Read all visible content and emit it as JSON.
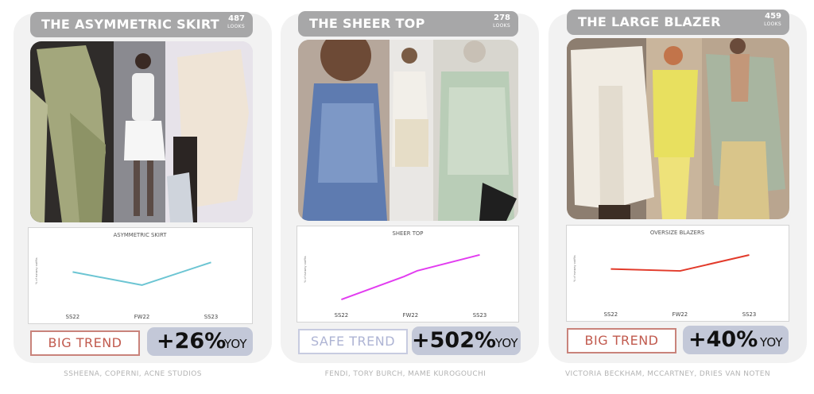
{
  "cards": [
    {
      "title": "THE ASYMMETRIC SKIRT",
      "looks_count": "487",
      "looks_label": "LOOKS",
      "trend_label": "BIG TREND",
      "yoy_value": "+26%",
      "yoy_label": "YOY",
      "brands": "SSHEENA, COPERNI, ACNE STUDIOS"
    },
    {
      "title": "THE SHEER TOP",
      "looks_count": "278",
      "looks_label": "LOOKS",
      "trend_label": "SAFE TREND",
      "yoy_value": "+502%",
      "yoy_label": "YOY",
      "brands": "FENDI, TORY BURCH, MAME KUROGOUCHI"
    },
    {
      "title": "THE LARGE BLAZER",
      "looks_count": "459",
      "looks_label": "LOOKS",
      "trend_label": "BIG TREND",
      "yoy_value": "+40%",
      "yoy_label": "YOY",
      "brands": "VICTORIA BECKHAM, MCCARTNEY, DRIES VAN NOTEN"
    }
  ],
  "chart_data": [
    {
      "type": "line",
      "title": "ASYMMETRIC SKIRT",
      "ylabel": "% of runway outfits",
      "categories": [
        "SS22",
        "FW22",
        "SS23"
      ],
      "x": [
        0,
        1,
        2
      ],
      "values": [
        0.78,
        0.48,
        1.0
      ],
      "ylim": [
        0,
        1.25
      ],
      "color": "#6cc5d3",
      "grid": false,
      "legend": false
    },
    {
      "type": "line",
      "title": "SHEER TOP",
      "ylabel": "% of runway outfits",
      "categories": [
        "SS22",
        "FW22",
        "SS23"
      ],
      "x": [
        0,
        0.9,
        1.1,
        2
      ],
      "values": [
        0.1,
        0.56,
        0.68,
        1.0
      ],
      "ylim": [
        0,
        1.1
      ],
      "color": "#e23cf0",
      "grid": false,
      "legend": false
    },
    {
      "type": "line",
      "title": "OVERSIZE BLAZERS",
      "ylabel": "% of runway outfits",
      "categories": [
        "SS22",
        "FW22",
        "SS23"
      ],
      "x": [
        0,
        1,
        2
      ],
      "values": [
        0.7,
        0.66,
        0.98
      ],
      "ylim": [
        0,
        1.1
      ],
      "color": "#e23a2a",
      "grid": false,
      "legend": false
    }
  ]
}
